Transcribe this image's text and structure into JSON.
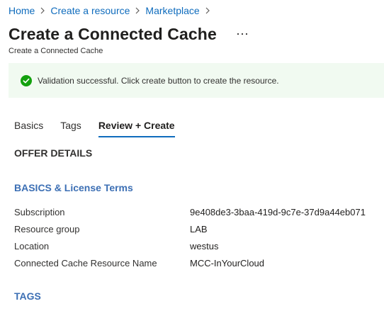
{
  "breadcrumb": [
    {
      "label": "Home"
    },
    {
      "label": "Create a resource"
    },
    {
      "label": "Marketplace"
    }
  ],
  "header": {
    "title": "Create a Connected Cache",
    "subtitle": "Create a Connected Cache",
    "more_label": "···"
  },
  "banner": {
    "message": "Validation successful. Click create button to create the resource.",
    "icon": "check-circle-icon",
    "color": "#13a10e",
    "background": "#f1faf1"
  },
  "tabs": [
    {
      "label": "Basics",
      "active": false
    },
    {
      "label": "Tags",
      "active": false
    },
    {
      "label": "Review + Create",
      "active": true
    }
  ],
  "sections": {
    "offer_details": "OFFER DETAILS",
    "basics": "BASICS & License Terms",
    "tags": "TAGS"
  },
  "details": [
    {
      "label": "Subscription",
      "value": "9e408de3-3baa-419d-9c7e-37d9a44eb071"
    },
    {
      "label": "Resource group",
      "value": "LAB"
    },
    {
      "label": "Location",
      "value": "westus"
    },
    {
      "label": "Connected Cache Resource Name",
      "value": "MCC-InYourCloud"
    }
  ],
  "colors": {
    "link": "#0f6cbd",
    "section_accent": "#3c6fb4",
    "tab_underline": "#0f6cbd"
  }
}
